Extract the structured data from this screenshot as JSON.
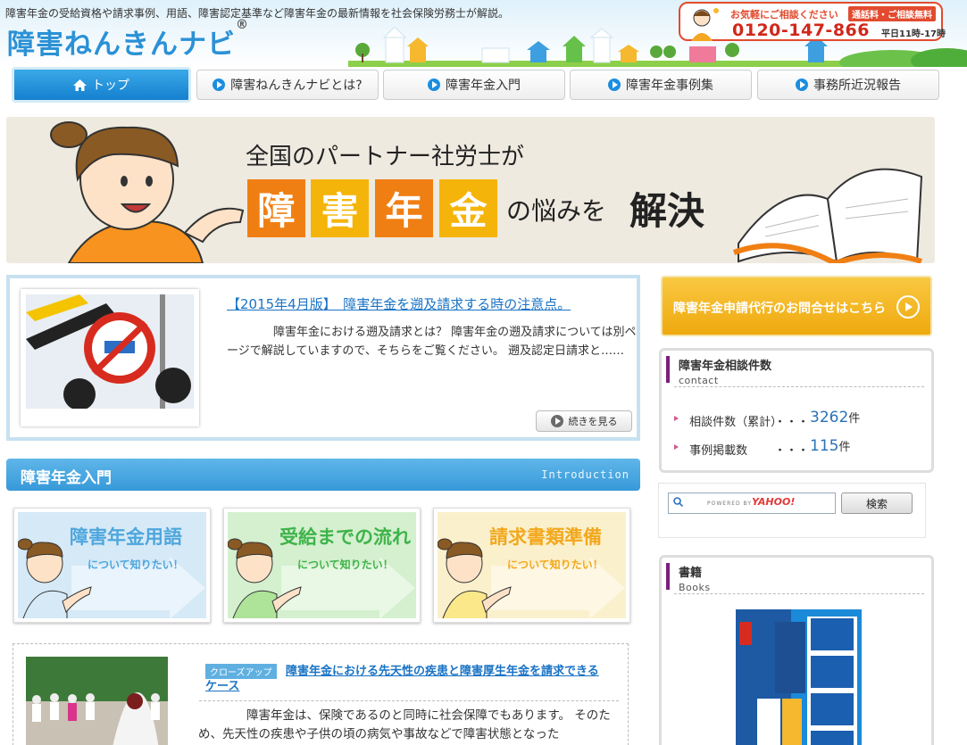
{
  "header": {
    "tagline": "障害年金の受給資格や請求事例、用語、障害認定基準など障害年金の最新情報を社会保険労務士が解説。",
    "logo": "障害ねんきんナビ",
    "logo_mark": "®",
    "contact": {
      "catch": "お気軽にご相談ください",
      "badge": "通話料・ご相談無料",
      "phone": "0120-147-866",
      "hours": "平日11時-17時"
    }
  },
  "nav": {
    "items": [
      {
        "label": "トップ"
      },
      {
        "label": "障害ねんきんナビとは?"
      },
      {
        "label": "障害年金入門"
      },
      {
        "label": "障害年金事例集"
      },
      {
        "label": "事務所近況報告"
      }
    ]
  },
  "hero": {
    "line1": "全国のパートナー社労士が",
    "chars": [
      "障",
      "害",
      "年",
      "金"
    ],
    "suffix1": "の悩みを",
    "suffix2": "解決"
  },
  "featured": {
    "title": "【2015年4月版】　障害年金を遡及請求する時の注意点。",
    "excerpt": "障害年金における遡及請求とは？ 障害年金の遡及請求については別ページで解説していますので、そちらをご覧ください。 遡及認定日請求と……",
    "more": "続きを見る"
  },
  "section": {
    "title": "障害年金入門",
    "sub": "Introduction"
  },
  "guides": [
    {
      "title": "障害年金用語",
      "sub": "について知りたい！"
    },
    {
      "title": "受給までの流れ",
      "sub": "について知りたい！"
    },
    {
      "title": "請求書類準備",
      "sub": "について知りたい！"
    }
  ],
  "closeup": {
    "badge": "クローズアップ",
    "title": "障害年金における先天性の疾患と障害厚生年金を請求できるケース",
    "excerpt": "障害年金は、保険であるのと同時に社会保障でもあります。 そのため、先天性の疾患や子供の頃の病気や事故などで障害状態となった"
  },
  "sidebar": {
    "cta": "障害年金申請代行のお問合せはこちら",
    "stats": {
      "title": "障害年金相談件数",
      "sub": "contact",
      "rows": [
        {
          "label": "相談件数（累計）",
          "dots": "・・・",
          "value": "3262",
          "unit": "件"
        },
        {
          "label": "事例掲載数",
          "dots": "・・・",
          "value": "115",
          "unit": "件"
        }
      ]
    },
    "search": {
      "powered": "POWERED BY",
      "yahoo": "YAHOO!",
      "button": "検索"
    },
    "books": {
      "title": "書籍",
      "sub": "Books"
    }
  }
}
